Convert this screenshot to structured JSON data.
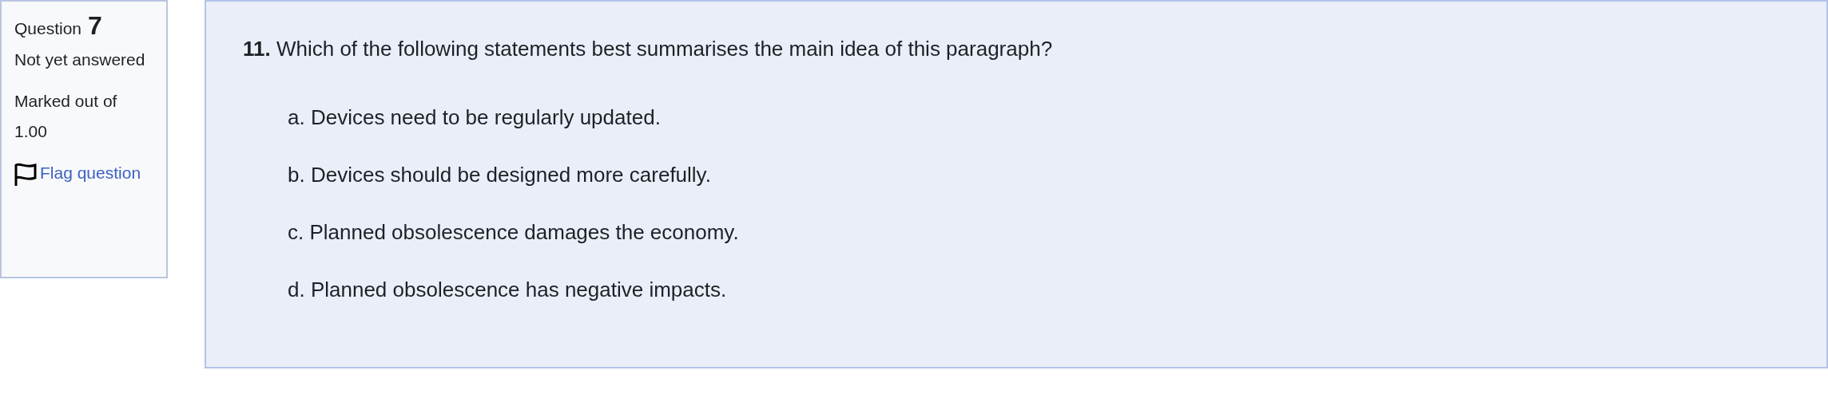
{
  "info": {
    "label": "Question",
    "number": "7",
    "state": "Not yet answered",
    "marks": "Marked out of 1.00",
    "flag": {
      "label": "Flag question",
      "flagged": false
    }
  },
  "question": {
    "text": "**11.** Which of the following statements best summarises the main idea of this paragraph?",
    "options": [
      {
        "label": "a. Devices need to be regularly updated."
      },
      {
        "label": "b. Devices should be designed more carefully."
      },
      {
        "label": "c. Planned obsolescence damages the economy."
      },
      {
        "label": "d. Planned obsolescence has negative impacts."
      }
    ]
  }
}
